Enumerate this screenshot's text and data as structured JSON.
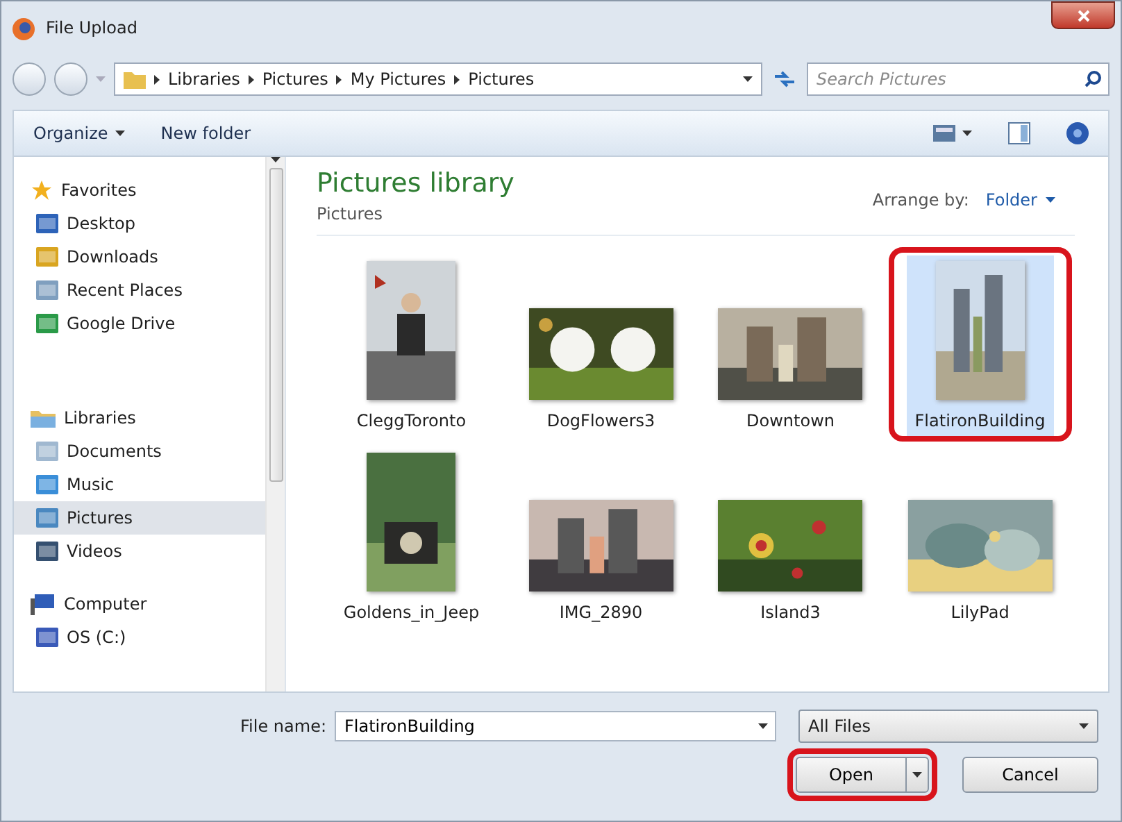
{
  "window": {
    "title": "File Upload"
  },
  "address": {
    "segments": [
      "Libraries",
      "Pictures",
      "My Pictures",
      "Pictures"
    ]
  },
  "search": {
    "placeholder": "Search Pictures"
  },
  "toolbar": {
    "organize": "Organize",
    "new_folder": "New folder"
  },
  "sidebar": {
    "groups": [
      {
        "label": "Favorites",
        "children": [
          {
            "label": "Desktop",
            "selected": false
          },
          {
            "label": "Downloads",
            "selected": false
          },
          {
            "label": "Recent Places",
            "selected": false
          },
          {
            "label": "Google Drive",
            "selected": false
          }
        ]
      },
      {
        "label": "Libraries",
        "children": [
          {
            "label": "Documents",
            "selected": false
          },
          {
            "label": "Music",
            "selected": false
          },
          {
            "label": "Pictures",
            "selected": true
          },
          {
            "label": "Videos",
            "selected": false
          }
        ]
      },
      {
        "label": "Computer",
        "children": [
          {
            "label": "OS (C:)",
            "selected": false
          }
        ]
      }
    ]
  },
  "library": {
    "title": "Pictures library",
    "subtitle": "Pictures",
    "arrange_label": "Arrange by:",
    "arrange_value": "Folder"
  },
  "files": [
    {
      "name": "CleggToronto",
      "selected": false,
      "annotated": false
    },
    {
      "name": "DogFlowers3",
      "selected": false,
      "annotated": false
    },
    {
      "name": "Downtown",
      "selected": false,
      "annotated": false
    },
    {
      "name": "FlatironBuilding",
      "selected": true,
      "annotated": true
    },
    {
      "name": "Goldens_in_Jeep",
      "selected": false,
      "annotated": false
    },
    {
      "name": "IMG_2890",
      "selected": false,
      "annotated": false
    },
    {
      "name": "Island3",
      "selected": false,
      "annotated": false
    },
    {
      "name": "LilyPad",
      "selected": false,
      "annotated": false
    }
  ],
  "footer": {
    "file_name_label": "File name:",
    "file_name_value": "FlatironBuilding",
    "file_type": "All Files",
    "open": {
      "label": "Open",
      "annotated": true
    },
    "cancel": "Cancel"
  }
}
